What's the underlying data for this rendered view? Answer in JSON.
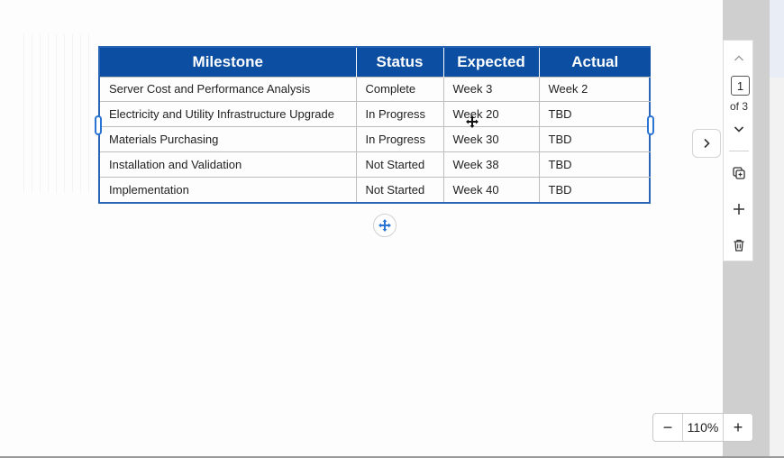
{
  "table": {
    "headers": [
      "Milestone",
      "Status",
      "Expected",
      "Actual"
    ],
    "rows": [
      [
        "Server Cost and Performance Analysis",
        "Complete",
        "Week 3",
        "Week 2"
      ],
      [
        "Electricity and Utility Infrastructure Upgrade",
        "In Progress",
        "Week 20",
        "TBD"
      ],
      [
        "Materials Purchasing",
        "In Progress",
        "Week 30",
        "TBD"
      ],
      [
        "Installation and Validation",
        "Not Started",
        "Week 38",
        "TBD"
      ],
      [
        "Implementation",
        "Not Started",
        "Week 40",
        "TBD"
      ]
    ]
  },
  "pager": {
    "current": "1",
    "of_label": "of 3"
  },
  "zoom": {
    "minus": "−",
    "value": "110%",
    "plus": "+"
  },
  "icons": {
    "move": "move-arrows-icon",
    "next": "chevron-right-icon",
    "up": "chevron-up-icon",
    "down": "chevron-down-icon",
    "duplicate": "duplicate-page-icon",
    "add": "add-page-icon",
    "delete": "trash-icon"
  },
  "colors": {
    "header_bg": "#0b4ea2",
    "accent": "#2a74d4"
  }
}
